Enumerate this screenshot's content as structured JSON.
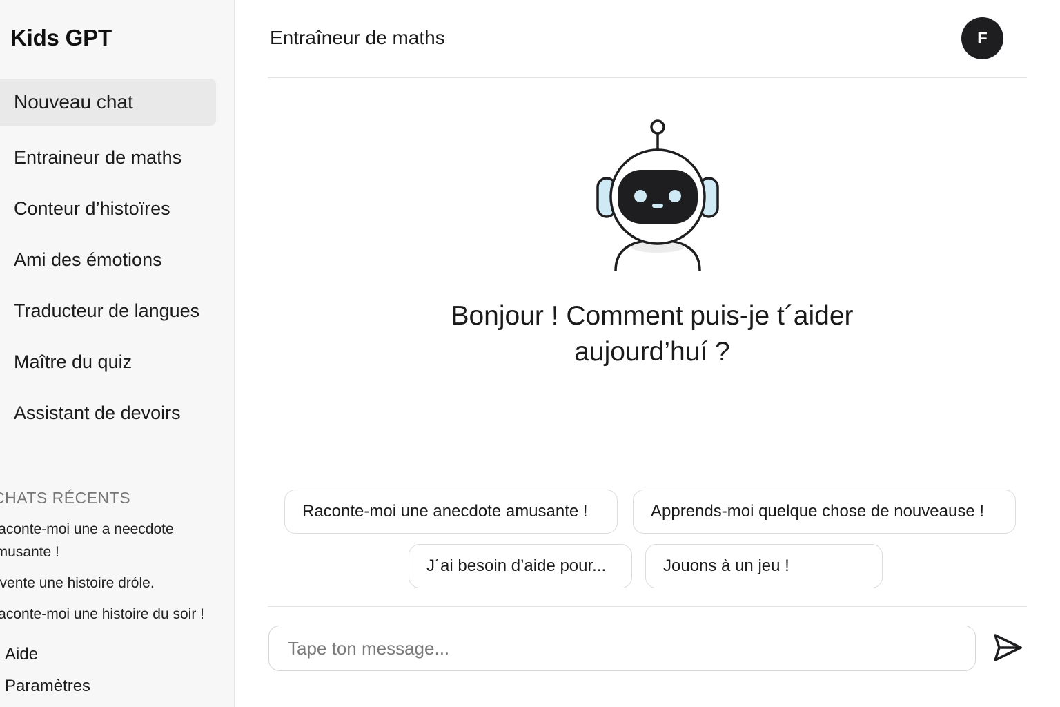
{
  "sidebar": {
    "brand": "Kids GPT",
    "new_chat": "Nouveau chat",
    "items": [
      {
        "label": "Entraineur de maths"
      },
      {
        "label": "Conteur d’histoïres"
      },
      {
        "label": "Ami des émotions"
      },
      {
        "label": "Traducteur de langues"
      },
      {
        "label": "Maître du quiz"
      },
      {
        "label": "Assistant de devoirs"
      }
    ],
    "recent_title": "CHATS RÉCENTS",
    "recent": [
      {
        "label": "Raconte-moi une a neecdote amusante !"
      },
      {
        "label": "Invente une histoire dróle."
      },
      {
        "label": "Raconte-moi une histoire du soir !"
      }
    ],
    "footer": {
      "help": "Aide",
      "settings": "Paramètres"
    }
  },
  "header": {
    "title": "Entraîneur de maths",
    "avatar_initial": "F"
  },
  "main": {
    "greeting": "Bonjour ! Comment puis-je t´aider aujourd’huí ?",
    "suggestions": [
      {
        "label": "Raconte-moi une anecdote amusante !"
      },
      {
        "label": "Apprends-moi quelque chose de nouveause !"
      },
      {
        "label": "J´ai besoin d’aide pour..."
      },
      {
        "label": "Jouons à un jeu !"
      }
    ]
  },
  "composer": {
    "placeholder": "Tape ton message..."
  },
  "colors": {
    "sidebar_bg": "#f7f7f7",
    "active_item_bg": "#e9e9e9",
    "avatar_bg": "#1e1e20",
    "robot_visor": "#1e1e20",
    "robot_eyes": "#cfeaf5",
    "border": "#dcdcdc"
  },
  "icons": {
    "robot": "robot-mascot-icon",
    "send": "send-icon"
  }
}
